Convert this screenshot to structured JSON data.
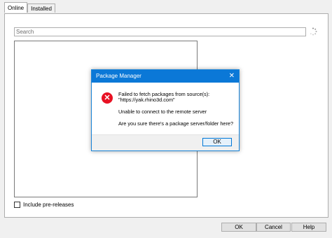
{
  "tabs": [
    "Online",
    "Installed"
  ],
  "search": {
    "placeholder": "Search"
  },
  "include_prerelease_label": "Include pre-releases",
  "buttons": {
    "ok": "OK",
    "cancel": "Cancel",
    "help": "Help"
  },
  "dialog": {
    "title": "Package Manager",
    "close": "✕",
    "error_icon": "✕",
    "line1": "Failed to fetch packages from source(s):",
    "line2": "\"https://yak.rhino3d.com\"",
    "line3": "Unable to connect to the remote server",
    "line4": "Are you sure there's a package server/folder here?",
    "ok": "OK"
  }
}
